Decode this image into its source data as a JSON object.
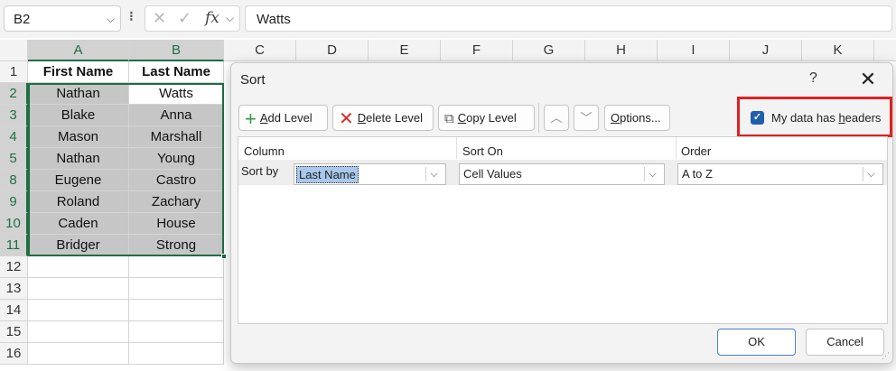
{
  "formula_bar": {
    "name_box": "B2",
    "name_box_dropdown": "⌵",
    "dots": "⁝",
    "cancel_icon": "✕",
    "enter_icon": "✓",
    "fx_label": "fx",
    "fx_dropdown": "⌵",
    "formula": "Watts"
  },
  "columns": [
    "A",
    "B",
    "C",
    "D",
    "E",
    "F",
    "G",
    "H",
    "I",
    "J",
    "K"
  ],
  "rows": [
    {
      "num": "1",
      "a": "First Name",
      "b": "Last Name"
    },
    {
      "num": "2",
      "a": "Nathan",
      "b": "Watts"
    },
    {
      "num": "3",
      "a": "Blake",
      "b": "Anna"
    },
    {
      "num": "4",
      "a": "Mason",
      "b": "Marshall"
    },
    {
      "num": "5",
      "a": "Nathan",
      "b": "Young"
    },
    {
      "num": "8",
      "a": "Eugene",
      "b": "Castro"
    },
    {
      "num": "9",
      "a": "Roland",
      "b": "Zachary"
    },
    {
      "num": "10",
      "a": "Caden",
      "b": "House"
    },
    {
      "num": "11",
      "a": "Bridger",
      "b": "Strong"
    },
    {
      "num": "12",
      "a": "",
      "b": ""
    },
    {
      "num": "13",
      "a": "",
      "b": ""
    },
    {
      "num": "14",
      "a": "",
      "b": ""
    },
    {
      "num": "15",
      "a": "",
      "b": ""
    },
    {
      "num": "16",
      "a": "",
      "b": ""
    }
  ],
  "dialog": {
    "title": "Sort",
    "help": "?",
    "close": "✕",
    "add_icon": "+",
    "add_label_u": "A",
    "add_label_rest": "dd Level",
    "delete_icon": "✕",
    "delete_label_u": "D",
    "delete_label_rest": "elete Level",
    "copy_icon": "⧉",
    "copy_label_u": "C",
    "copy_label_rest": "opy Level",
    "move_up_icon": "︿",
    "move_down_icon": "﹀",
    "options_label_u": "O",
    "options_label_rest": "ptions...",
    "headers_check": "✓",
    "headers_label_pre": "My data has ",
    "headers_label_u": "h",
    "headers_label_rest": "eaders",
    "col_header": "Column",
    "sorton_header": "Sort On",
    "order_header": "Order",
    "sort_by": "Sort by",
    "column_value": "Last Name",
    "sorton_value": "Cell Values",
    "order_value": "A to Z",
    "dropdown_icon": "⌵",
    "ok": "OK",
    "cancel": "Cancel",
    "resize_grip": "⋰"
  }
}
